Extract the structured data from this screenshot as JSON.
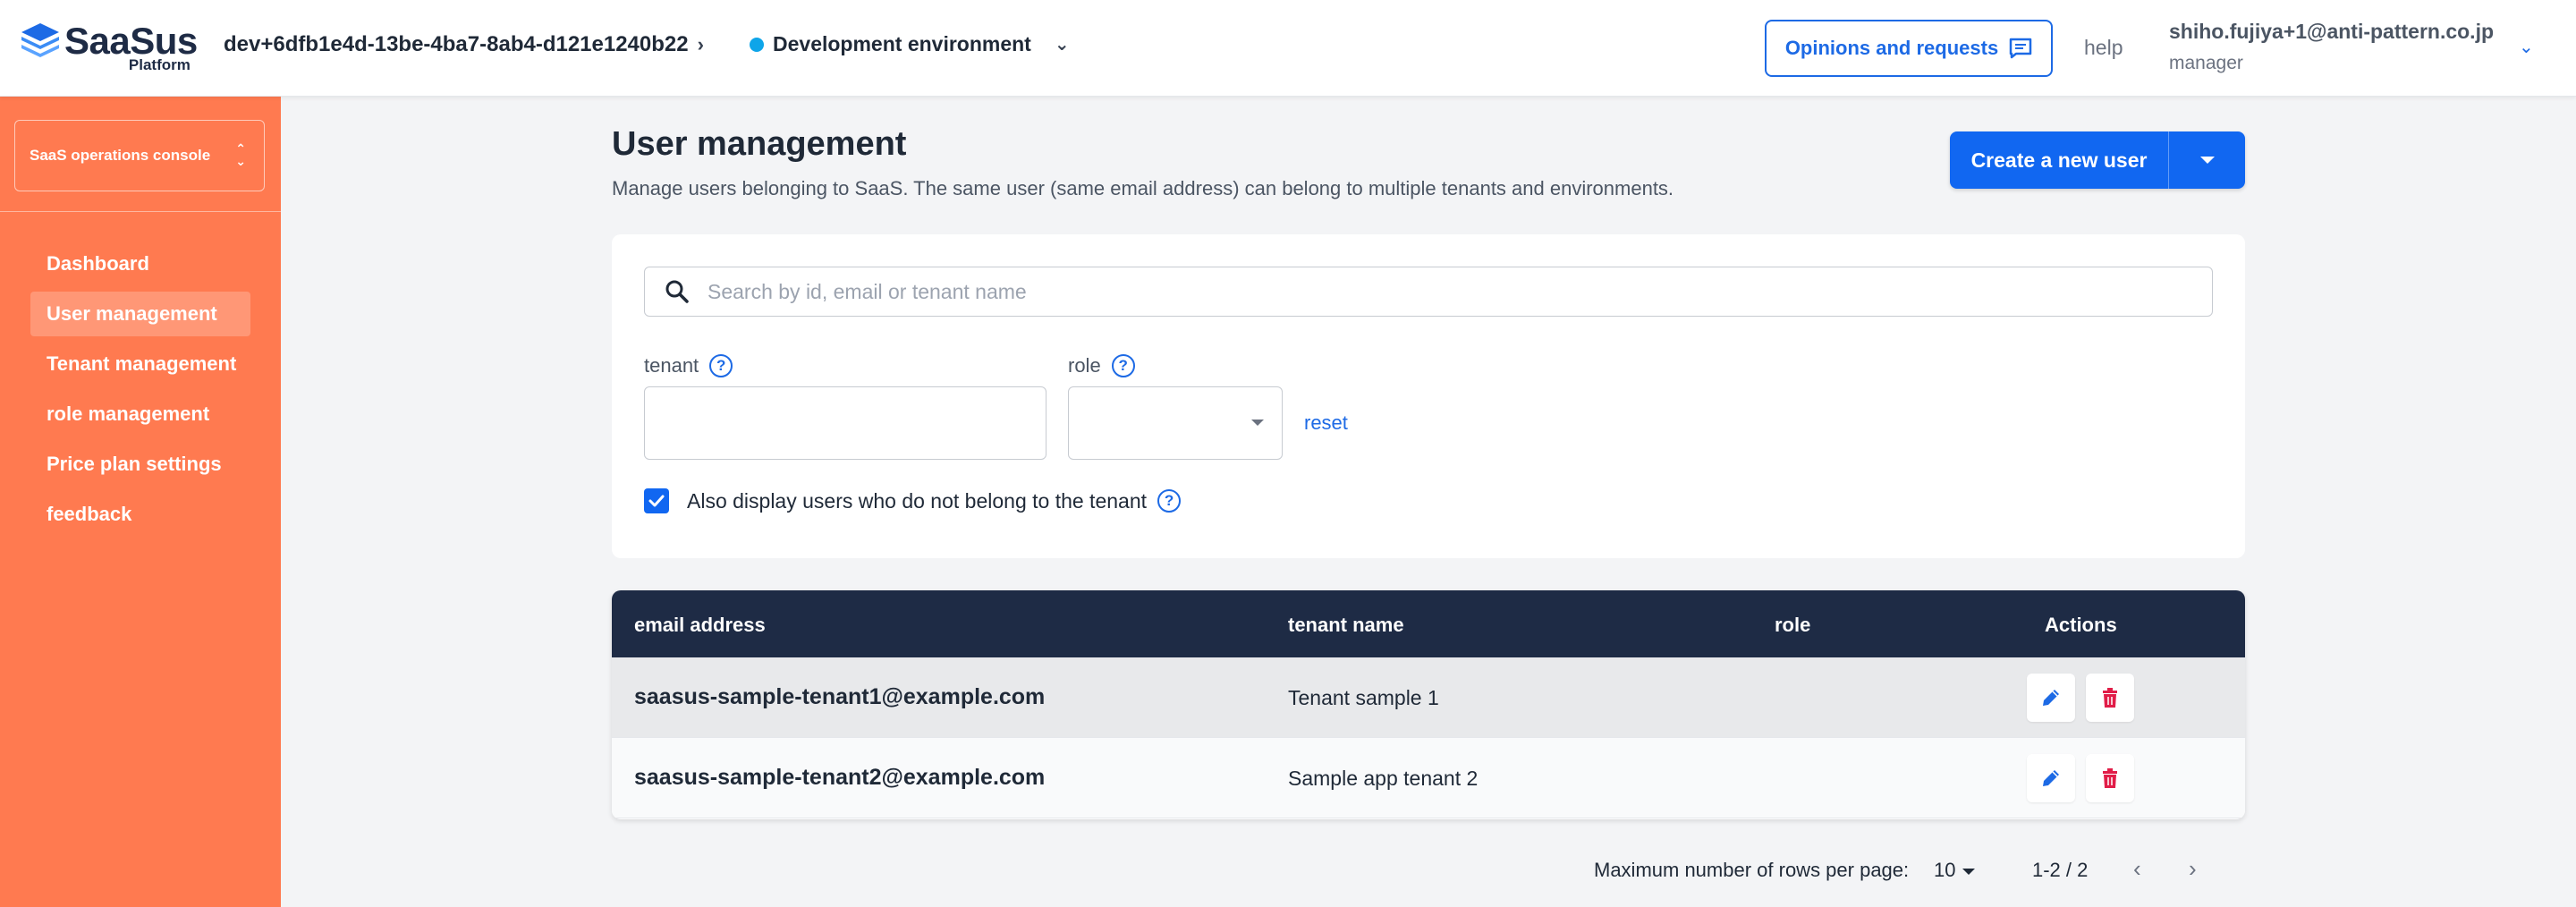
{
  "header": {
    "logo_name": "SaaSus",
    "logo_sub": "Platform",
    "env_id": "dev+6dfb1e4d-13be-4ba7-8ab4-d121e1240b22",
    "env_name": "Development environment",
    "env_dot_color": "#0ea5e9",
    "opinions_label": "Opinions and requests",
    "help_label": "help",
    "user_email": "shiho.fujiya+1@anti-pattern.co.jp",
    "user_role": "manager"
  },
  "sidebar": {
    "console_label": "SaaS operations console",
    "items": [
      {
        "label": "Dashboard",
        "active": false
      },
      {
        "label": "User management",
        "active": true
      },
      {
        "label": "Tenant management",
        "active": false
      },
      {
        "label": "role management",
        "active": false
      },
      {
        "label": "Price plan settings",
        "active": false
      },
      {
        "label": "feedback",
        "active": false
      }
    ]
  },
  "main": {
    "title": "User management",
    "description": "Manage users belonging to SaaS. The same user (same email address) can belong to multiple tenants and environments.",
    "create_button": "Create a new user"
  },
  "filters": {
    "search_placeholder": "Search by id, email or tenant name",
    "tenant_label": "tenant",
    "role_label": "role",
    "reset_label": "reset",
    "checkbox_label": "Also display users who do not belong to the tenant",
    "checkbox_checked": true
  },
  "table": {
    "columns": [
      "email address",
      "tenant name",
      "role",
      "Actions"
    ],
    "rows": [
      {
        "email": "saasus-sample-tenant1@example.com",
        "tenant": "Tenant sample 1",
        "role": ""
      },
      {
        "email": "saasus-sample-tenant2@example.com",
        "tenant": "Sample app tenant 2",
        "role": ""
      }
    ]
  },
  "pagination": {
    "rows_label": "Maximum number of rows per page:",
    "rows_value": "10",
    "range": "1-2 / 2"
  },
  "colors": {
    "sidebar": "#ff7a50",
    "primary": "#1167f1",
    "table_header": "#1e2b45",
    "delete": "#e11d48"
  }
}
